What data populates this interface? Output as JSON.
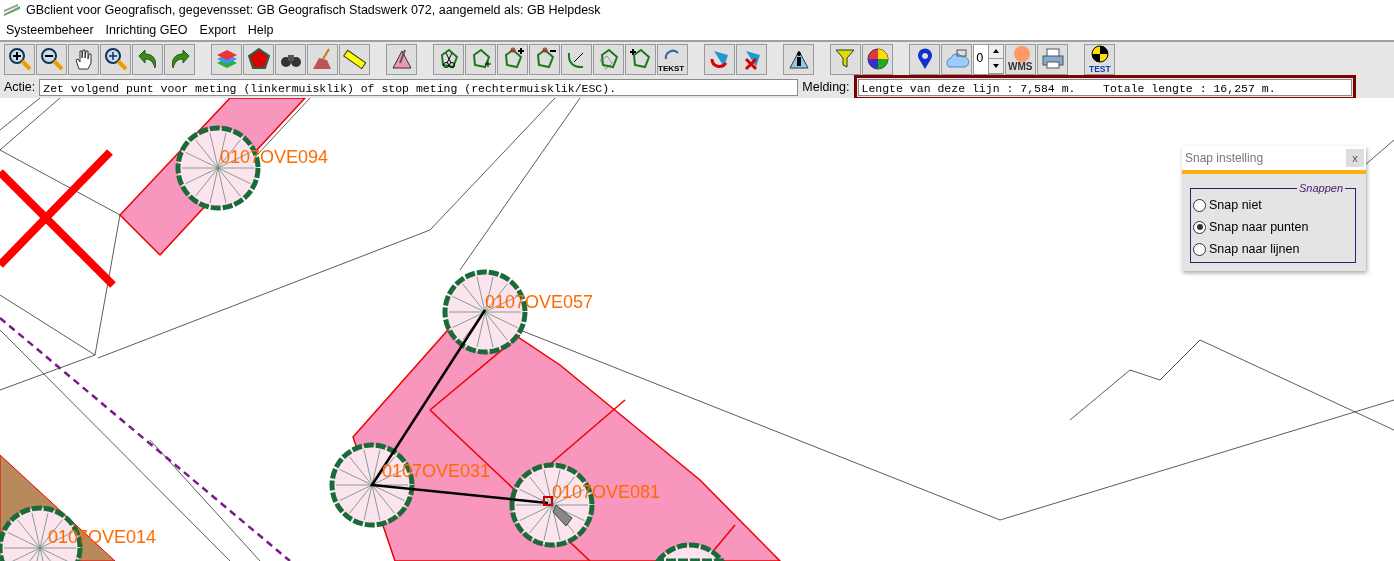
{
  "window": {
    "title": "GBclient voor Geografisch, gegevensset: GB Geografisch Stadswerk 072, aangemeld als: GB Helpdesk"
  },
  "menu": [
    "Systeembeheer",
    "Inrichting GEO",
    "Export",
    "Help"
  ],
  "toolbar": {
    "tekst_label": "TEKST",
    "spinner_value": "0",
    "wms_label": "WMS",
    "test_label": "TEST"
  },
  "action": {
    "label": "Actie:",
    "value": "Zet volgend punt voor meting (linkermuisklik) of stop meting (rechtermuisklik/ESC)."
  },
  "message": {
    "label": "Melding:",
    "value": "Lengte van deze lijn : 7,584 m.    Totale lengte : 16,257 m.",
    "highlighted": true
  },
  "map": {
    "labels": [
      {
        "text": "0107OVE094"
      },
      {
        "text": "0107OVE057"
      },
      {
        "text": "0107OVE031"
      },
      {
        "text": "0107OVE081"
      },
      {
        "text": "0107OVE014"
      }
    ]
  },
  "snap_dialog": {
    "title": "Snap instelling",
    "close": "x",
    "group": "Snappen",
    "options": [
      {
        "label": "Snap niet",
        "selected": false
      },
      {
        "label": "Snap naar punten",
        "selected": true
      },
      {
        "label": "Snap naar lijnen",
        "selected": false
      }
    ]
  }
}
